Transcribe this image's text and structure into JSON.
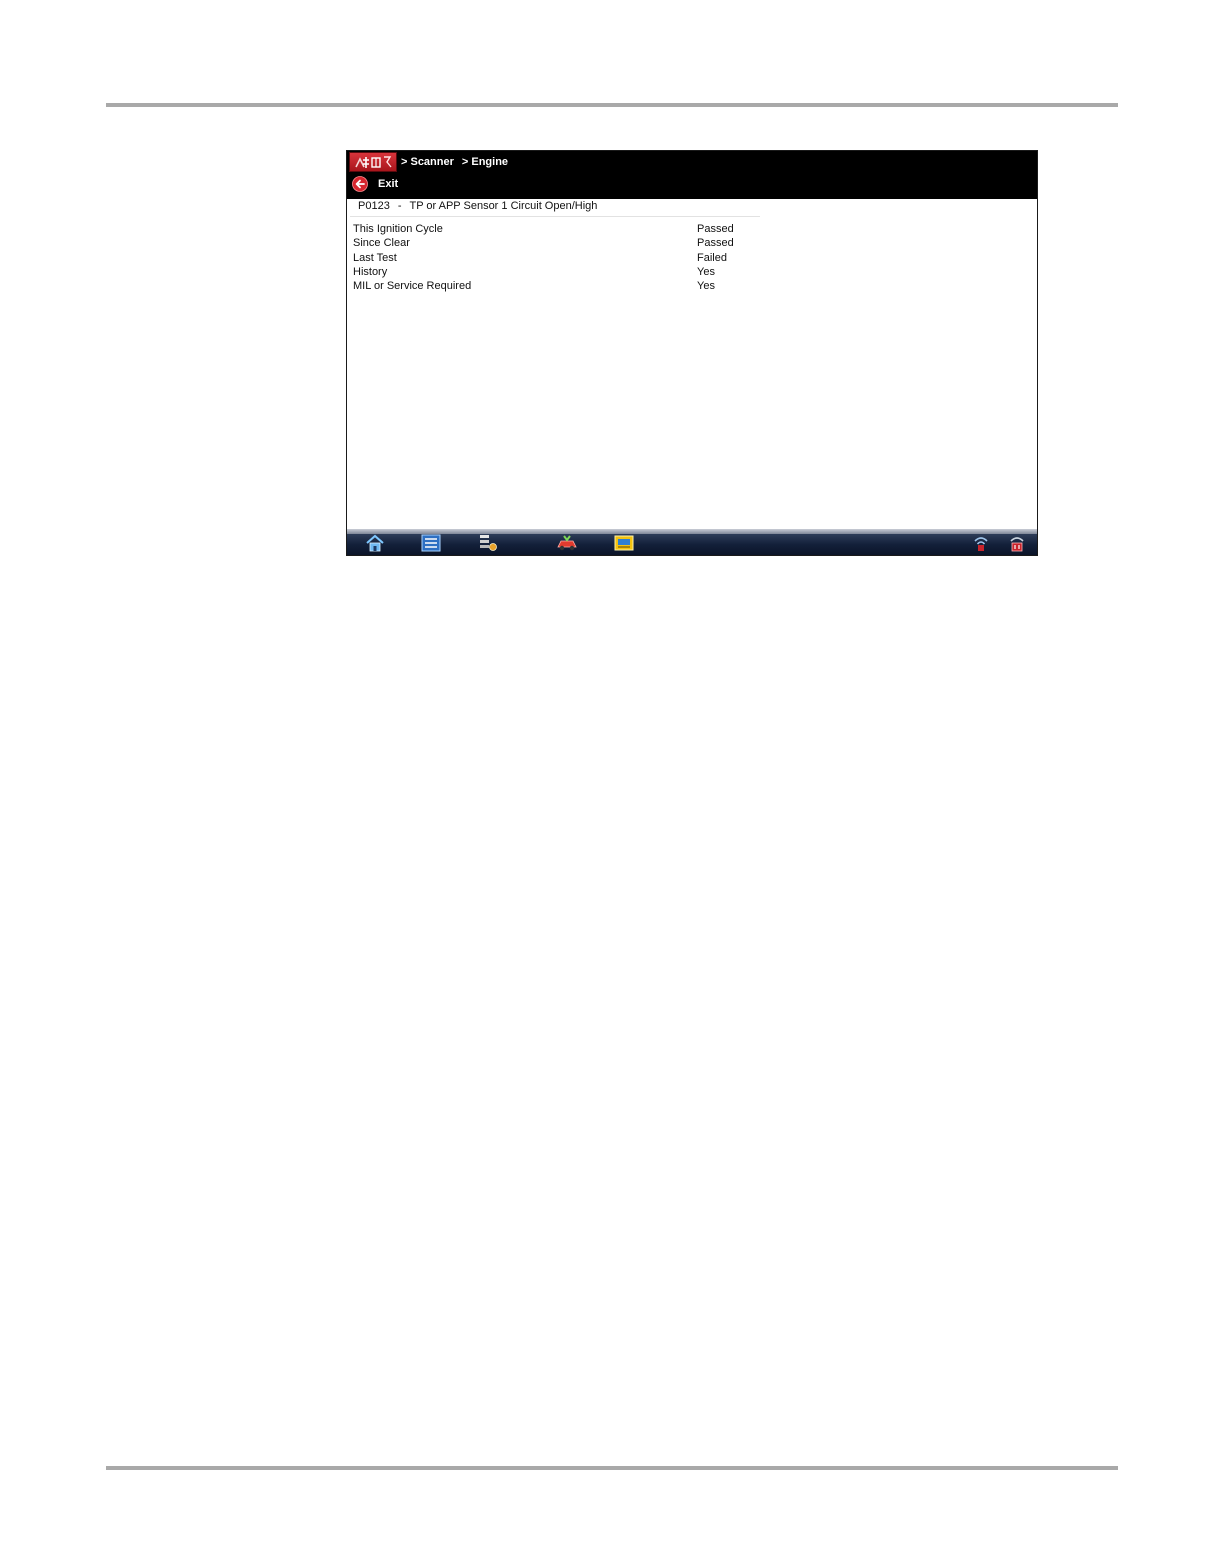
{
  "titlebar": {
    "logo_icon": "vehicle-logo-icon",
    "breadcrumb": [
      "> Scanner",
      "> Engine"
    ]
  },
  "toolbar": {
    "exit_label": "Exit",
    "exit_icon": "back-arrow-icon"
  },
  "dtc": {
    "code": "P0123",
    "separator": "-",
    "description": "TP or APP Sensor 1 Circuit Open/High"
  },
  "status_rows": [
    {
      "label": "This Ignition Cycle",
      "value": "Passed"
    },
    {
      "label": "Since Clear",
      "value": "Passed"
    },
    {
      "label": "Last Test",
      "value": "Failed"
    },
    {
      "label": "History",
      "value": "Yes"
    },
    {
      "label": "MIL or Service Required",
      "value": "Yes"
    }
  ],
  "taskbar": {
    "icons": [
      "home-icon",
      "data-list-icon",
      "settings-list-icon",
      "vehicle-id-icon",
      "shop-icon",
      "wireless-icon",
      "connection-icon"
    ]
  },
  "colors": {
    "titlebar_bg": "#000000",
    "logo_red": "#c8232c",
    "exit_icon_red": "#d7262e",
    "taskbar_dark": "#13203a"
  }
}
